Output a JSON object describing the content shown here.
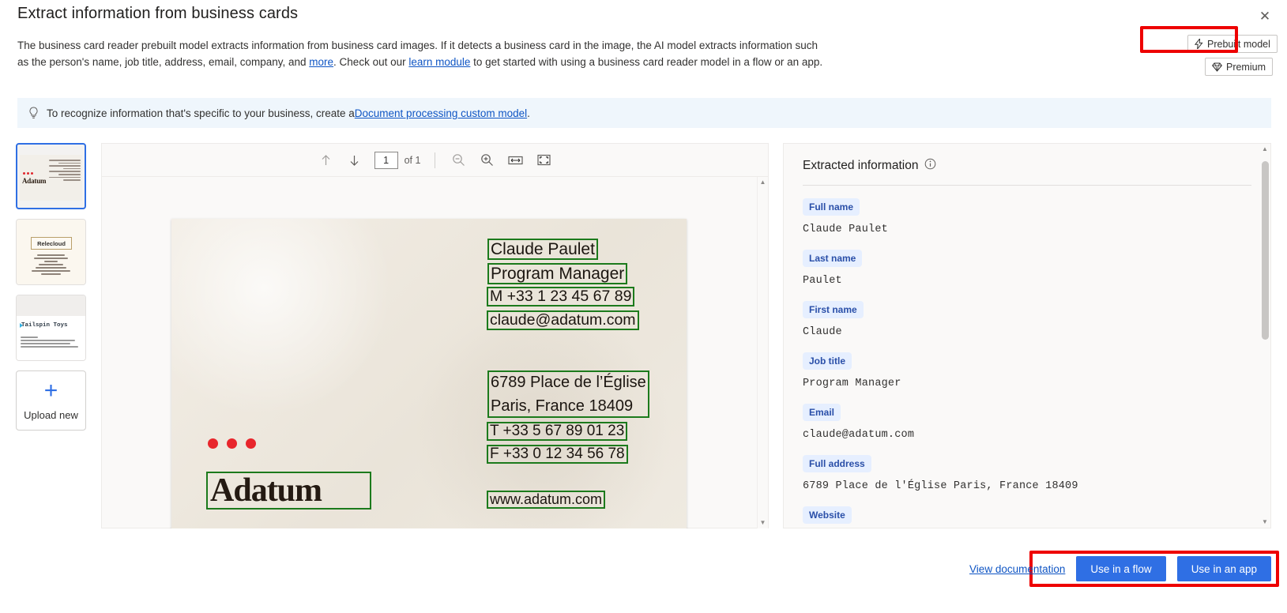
{
  "dialog": {
    "title": "Extract information from business cards",
    "close_icon": "close-icon",
    "description_parts": {
      "p1": "The business card reader prebuilt model extracts information from business card images. If it detects a business card in the image, the AI model extracts information such as the person's name, job title, address, email, company, and ",
      "link_more": "more",
      "p2": ". Check out our ",
      "link_learn": "learn module",
      "p3": " to get started with using a business card reader model in a flow or an app."
    }
  },
  "badges": [
    {
      "label": "Prebuilt model",
      "icon": "lightning-icon"
    },
    {
      "label": "Premium",
      "icon": "diamond-icon"
    }
  ],
  "infobar": {
    "icon": "lightbulb-icon",
    "text_before": "To recognize information that's specific to your business, create a ",
    "link": "Document processing custom model",
    "text_after": "."
  },
  "thumbnails": [
    {
      "name": "Adatum",
      "selected": true
    },
    {
      "name": "Relecloud",
      "selected": false
    },
    {
      "name": "Tailspin Toys",
      "selected": false
    }
  ],
  "upload": {
    "label": "Upload new",
    "icon": "plus-icon"
  },
  "viewer": {
    "toolbar": {
      "prev_icon": "arrow-up-icon",
      "next_icon": "arrow-down-icon",
      "page_value": "1",
      "page_total": "of 1",
      "zoom_out_icon": "zoom-out-icon",
      "zoom_in_icon": "zoom-in-icon",
      "fit_width_icon": "fit-width-icon",
      "fullscreen_icon": "fullscreen-icon"
    },
    "card": {
      "logo": "Adatum",
      "ocr_lines": [
        "Claude Paulet",
        "Program Manager",
        "M +33 1 23 45 67 89",
        "claude@adatum.com",
        "6789 Place de l’Église",
        "Paris, France 18409",
        "T +33 5 67 89 01 23",
        "F +33 0 12 34 56 78",
        "www.adatum.com"
      ]
    }
  },
  "panel": {
    "title": "Extracted information",
    "info_icon": "info-icon",
    "fields": [
      {
        "label": "Full name",
        "value": "Claude Paulet"
      },
      {
        "label": "Last name",
        "value": "Paulet"
      },
      {
        "label": "First name",
        "value": "Claude"
      },
      {
        "label": "Job title",
        "value": "Program Manager"
      },
      {
        "label": "Email",
        "value": "claude@adatum.com"
      },
      {
        "label": "Full address",
        "value": "6789 Place de l'Église Paris, France 18409"
      },
      {
        "label": "Website",
        "value": ""
      }
    ]
  },
  "footer": {
    "documentation_link": "View documentation",
    "use_in_flow": "Use in a flow",
    "use_in_app": "Use in an app"
  },
  "colors": {
    "accent": "#2f6fe4",
    "link": "#0f55c4",
    "ocr_box": "#1c7a1c",
    "annotation": "#ee0000",
    "chip_bg": "#e6efff",
    "chip_text": "#2a4fa8",
    "infobar_bg": "#eff6fc"
  }
}
